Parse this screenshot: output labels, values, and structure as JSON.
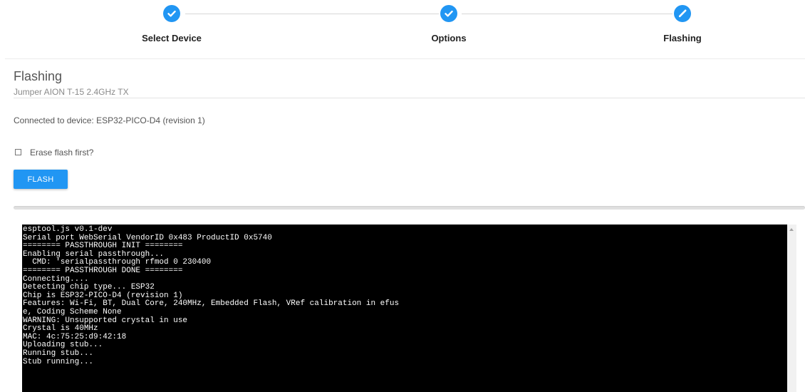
{
  "stepper": {
    "steps": [
      {
        "label": "Select Device",
        "state": "complete",
        "icon": "check-icon"
      },
      {
        "label": "Options",
        "state": "complete",
        "icon": "check-icon"
      },
      {
        "label": "Flashing",
        "state": "active",
        "icon": "pencil-icon"
      }
    ],
    "accent_color": "#2196f3"
  },
  "header": {
    "title": "Flashing",
    "subtitle": "Jumper AION T-15 2.4GHz TX"
  },
  "status": {
    "connected_text": "Connected to device: ESP32-PICO-D4 (revision 1)"
  },
  "options": {
    "erase_label": "Erase flash first?",
    "erase_checked": false
  },
  "actions": {
    "flash_label": "FLASH"
  },
  "progress": {
    "percent": 0
  },
  "terminal": {
    "lines": [
      "esptool.js v0.1-dev",
      "Serial port WebSerial VendorID 0x483 ProductID 0x5740",
      "======== PASSTHROUGH INIT ========",
      "Enabling serial passthrough...",
      "  CMD: 'serialpassthrough rfmod 0 230400",
      "======== PASSTHROUGH DONE ========",
      "Connecting....",
      "Detecting chip type... ESP32",
      "Chip is ESP32-PICO-D4 (revision 1)",
      "Features: Wi-Fi, BT, Dual Core, 240MHz, Embedded Flash, VRef calibration in efus",
      "e, Coding Scheme None",
      "WARNING: Unsupported crystal in use",
      "Crystal is 40MHz",
      "MAC: 4c:75:25:d9:42:18",
      "Uploading stub...",
      "Running stub...",
      "Stub running..."
    ]
  }
}
